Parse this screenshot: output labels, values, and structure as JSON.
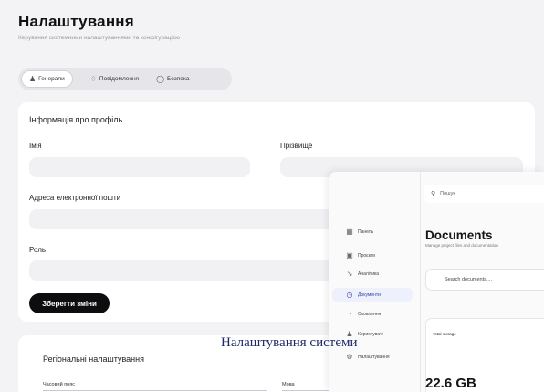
{
  "header": {
    "title": "Налаштування",
    "subtitle": "Керування системними налаштуваннями та конфігурацією"
  },
  "tabs": [
    {
      "label": "Генерали",
      "icon": "user-icon",
      "active": true
    },
    {
      "label": "Повідомлення",
      "icon": "bell-icon",
      "active": false
    },
    {
      "label": "Безпека",
      "icon": "shield-icon",
      "active": false
    }
  ],
  "profile": {
    "title": "Інформація про профіль",
    "first_name_label": "Ім'я",
    "last_name_label": "Прізвище",
    "email_label": "Адреса електронної пошти",
    "role_label": "Роль",
    "save_label": "Зберегти зміни"
  },
  "regional": {
    "title": "Регіональні налаштування",
    "timezone_label": "Часовий пояс",
    "language_label": "Мова"
  },
  "overlay": {
    "search_placeholder": "Пошук",
    "nav": [
      {
        "label": "Панель",
        "icon": "grid-icon",
        "active": false
      },
      {
        "label": "Проєкти",
        "icon": "folder-icon",
        "active": false
      },
      {
        "label": "Аналітика",
        "icon": "chart-icon",
        "active": false
      },
      {
        "label": "Документи",
        "icon": "document-icon",
        "active": true
      },
      {
        "label": "Сховлення",
        "icon": "storage-icon",
        "active": false
      },
      {
        "label": "Користувачі",
        "icon": "users-icon",
        "active": false
      },
      {
        "label": "Налаштування",
        "icon": "gear-icon",
        "active": false
      }
    ],
    "title": "Documents",
    "subtitle": "Manage project files and documentation",
    "doc_search_placeholder": "Search documents....",
    "storage_label": "Total storage",
    "storage_value": "22.6 GB"
  },
  "watermark": "Налаштування системи",
  "colors": {
    "accent": "#3c44a8",
    "primary_button": "#0d0d0f",
    "background": "#f3f3f5"
  }
}
